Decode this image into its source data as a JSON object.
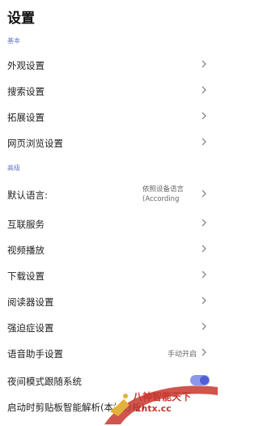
{
  "header": {
    "title": "设置"
  },
  "sections": {
    "basic": "基本",
    "advanced": "高级"
  },
  "rows": {
    "appearance": "外观设置",
    "search": "搜索设置",
    "extensions": "拓展设置",
    "browsing": "网页浏览设置",
    "default_language": {
      "label": "默认语言:",
      "value_line1": "依照设备语言",
      "value_line2": "(According"
    },
    "interconnect": "互联服务",
    "video": "视频播放",
    "download": "下载设置",
    "reader": "阅读器设置",
    "ocd": "强迫症设置",
    "voice_assistant": {
      "label": "语音助手设置",
      "value": "手动开启"
    },
    "night_mode": {
      "label": "夜间模式跟随系统",
      "enabled": true
    },
    "clipboard": {
      "label": "启动时剪贴板智能解析(本地分析)"
    }
  },
  "watermark": {
    "line1": "八神智能天下",
    "line2": "zntx.cc"
  },
  "colors": {
    "section_label": "#6a7ac8",
    "toggle_on": "#4e5fd8",
    "watermark": "#c8372e"
  }
}
